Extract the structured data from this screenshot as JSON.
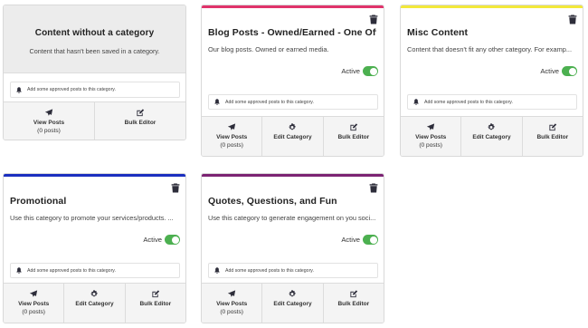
{
  "colors": {
    "toggle_active": "#4cb050",
    "icon": "#2d2d3a"
  },
  "uncategorized": {
    "title": "Content without a category",
    "description": "Content that hasn't been saved in a category.",
    "notice": "Add some approved posts to this category.",
    "view_label": "View Posts",
    "view_count": "(0 posts)",
    "bulk_label": "Bulk Editor"
  },
  "categories": [
    {
      "title": "Blog Posts - Owned/Earned - One Off",
      "description": "Our blog posts. Owned or earned media.",
      "active_label": "Active",
      "active": true,
      "color": "#e0336b",
      "notice": "Add some approved posts to this category.",
      "view_label": "View Posts",
      "view_count": "(0 posts)",
      "edit_label": "Edit Category",
      "bulk_label": "Bulk Editor"
    },
    {
      "title": "Misc Content",
      "description": "Content that doesn't fit any other category. For examp...",
      "active_label": "Active",
      "active": true,
      "color": "#f2e83a",
      "notice": "Add some approved posts to this category.",
      "view_label": "View Posts",
      "view_count": "(0 posts)",
      "edit_label": "Edit Category",
      "bulk_label": "Bulk Editor"
    },
    {
      "title": "Promotional",
      "description": "Use this category to promote your services/products. ...",
      "active_label": "Active",
      "active": true,
      "color": "#1b2fbf",
      "notice": "Add some approved posts to this category.",
      "view_label": "View Posts",
      "view_count": "(0 posts)",
      "edit_label": "Edit Category",
      "bulk_label": "Bulk Editor"
    },
    {
      "title": "Quotes, Questions, and Fun",
      "description": "Use this category to generate engagement on you soci...",
      "active_label": "Active",
      "active": true,
      "color": "#7c2373",
      "notice": "Add some approved posts to this category.",
      "view_label": "View Posts",
      "view_count": "(0 posts)",
      "edit_label": "Edit Category",
      "bulk_label": "Bulk Editor"
    }
  ]
}
